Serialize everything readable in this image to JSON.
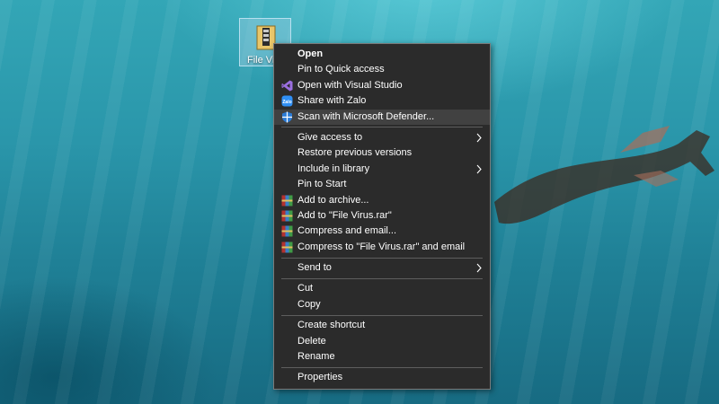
{
  "desktop": {
    "icon_label": "File Viru"
  },
  "context_menu": {
    "group1": [
      {
        "label": "Open",
        "bold": true,
        "icon": ""
      },
      {
        "label": "Pin to Quick access",
        "icon": ""
      },
      {
        "label": "Open with Visual Studio",
        "icon": "visual-studio-icon"
      },
      {
        "label": "Share with Zalo",
        "icon": "zalo-icon"
      },
      {
        "label": "Scan with Microsoft Defender...",
        "icon": "defender-shield-icon",
        "highlighted": true
      }
    ],
    "group2": [
      {
        "label": "Give access to",
        "submenu": true
      },
      {
        "label": "Restore previous versions"
      },
      {
        "label": "Include in library",
        "submenu": true
      },
      {
        "label": "Pin to Start"
      },
      {
        "label": "Add to archive...",
        "icon": "winrar-icon"
      },
      {
        "label": "Add to \"File Virus.rar\"",
        "icon": "winrar-icon"
      },
      {
        "label": "Compress and email...",
        "icon": "winrar-icon"
      },
      {
        "label": "Compress to \"File Virus.rar\" and email",
        "icon": "winrar-icon"
      }
    ],
    "group3": [
      {
        "label": "Send to",
        "submenu": true
      }
    ],
    "group4": [
      {
        "label": "Cut"
      },
      {
        "label": "Copy"
      }
    ],
    "group5": [
      {
        "label": "Create shortcut"
      },
      {
        "label": "Delete"
      },
      {
        "label": "Rename"
      }
    ],
    "group6": [
      {
        "label": "Properties"
      }
    ]
  },
  "colors": {
    "menu_bg": "#2b2b2b",
    "menu_hover": "#414141",
    "menu_border": "#7a7a7a",
    "text": "#ffffff"
  }
}
